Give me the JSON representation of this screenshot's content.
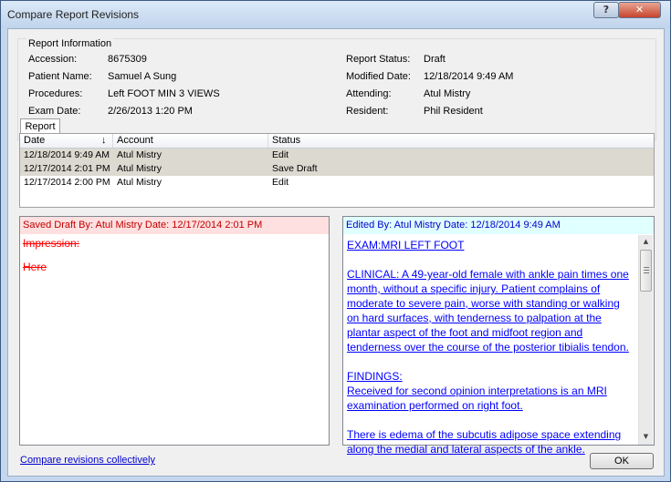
{
  "window": {
    "title": "Compare Report Revisions",
    "help_glyph": "?",
    "close_glyph": "✕"
  },
  "report_info": {
    "legend": "Report Information",
    "accession_label": "Accession:",
    "accession": "8675309",
    "patient_label": "Patient Name:",
    "patient": "Samuel A Sung",
    "procedures_label": "Procedures:",
    "procedures": "Left FOOT MIN 3 VIEWS",
    "exam_date_label": "Exam Date:",
    "exam_date": "2/26/2013 1:20 PM",
    "status_label": "Report Status:",
    "status": "Draft",
    "modified_label": "Modified Date:",
    "modified": "12/18/2014 9:49 AM",
    "attending_label": "Attending:",
    "attending": "Atul Mistry",
    "resident_label": "Resident:",
    "resident": "Phil Resident"
  },
  "tab": {
    "label": "Report"
  },
  "grid": {
    "headers": [
      "Date",
      "Account",
      "Status"
    ],
    "sort_icon": "↓",
    "rows": [
      [
        "12/18/2014 9:49 AM",
        "Atul Mistry",
        "Edit"
      ],
      [
        "12/17/2014 2:01 PM",
        "Atul Mistry",
        "Save Draft"
      ],
      [
        "12/17/2014 2:00 PM",
        "Atul Mistry",
        "Edit"
      ]
    ],
    "colors": {
      "selected_row": "#dcd9d0",
      "white_row": "#ffffff"
    }
  },
  "left_panel": {
    "header": "Saved Draft By: Atul Mistry  Date: 12/17/2014 2:01 PM",
    "lines": [
      "Impression:",
      "Here"
    ],
    "header_bg": "#ffe0e0",
    "text_color": "#ff0000"
  },
  "right_panel": {
    "header": "Edited By: Atul Mistry  Date: 12/18/2014 9:49 AM",
    "lines": [
      "EXAM:MRI LEFT FOOT",
      "",
      "CLINICAL: A 49-year-old female with ankle pain times one",
      "month, without a specific injury. Patient complains of",
      "moderate to severe pain, worse with standing or walking",
      "on hard surfaces, with tenderness to palpation at the",
      "plantar aspect of the foot and midfoot region and",
      "tenderness over the course of the posterior tibialis tendon.",
      "",
      "FINDINGS:",
      "Received for second opinion interpretations is an MRI",
      "examination performed on right foot.",
      "",
      "There is edema of the subcutis adipose space extending",
      "along the medial and lateral aspects of the ankle."
    ],
    "header_bg": "#e0ffff",
    "text_color": "#0000ff",
    "scroll_up_glyph": "▲",
    "scroll_down_glyph": "▼"
  },
  "footer": {
    "compare_link": "Compare revisions collectively",
    "ok_label": "OK"
  }
}
